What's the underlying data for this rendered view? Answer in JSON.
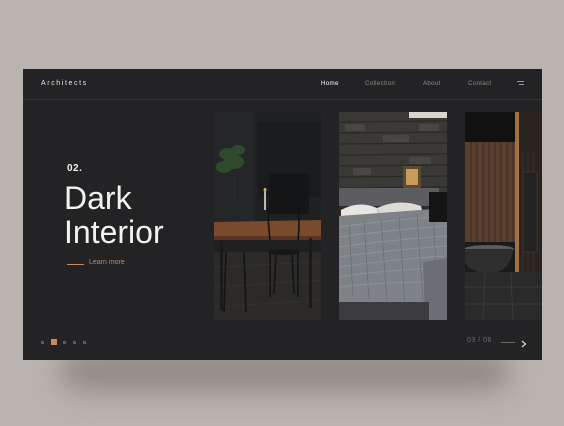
{
  "brand": "Architects",
  "nav": {
    "home": "Home",
    "collection": "Collection",
    "about": "About",
    "contact": "Contact",
    "menu_icon": "hamburger-icon"
  },
  "hero": {
    "number": "02.",
    "title_line1": "Dark",
    "title_line2": "Interior",
    "cta": "Learn more"
  },
  "gallery": [
    {
      "subject": "dining room with wooden table"
    },
    {
      "subject": "bedroom with grey knitted blanket"
    },
    {
      "subject": "bathroom with dark stone tiles"
    }
  ],
  "slider": {
    "total_dots": 5,
    "active_dot": 2,
    "counter": "03 / 06",
    "next_icon": "chevron-right-icon"
  },
  "colors": {
    "background": "#b9b4b0",
    "panel": "#232326",
    "accent": "#c98a57",
    "text": "#f4f2ef"
  }
}
